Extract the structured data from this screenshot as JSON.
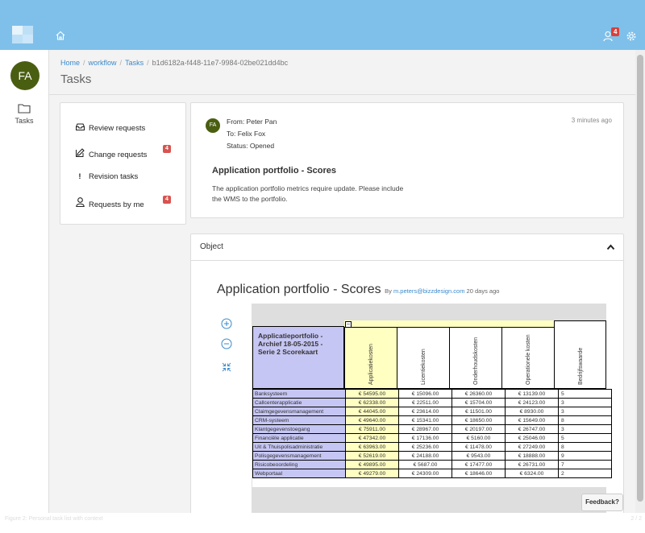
{
  "topbar": {
    "notification_count": "4"
  },
  "sidebar": {
    "avatar_initials": "FA",
    "items": [
      {
        "label": "Tasks"
      }
    ]
  },
  "breadcrumb": {
    "home": "Home",
    "workflow": "workflow",
    "tasks": "Tasks",
    "current": "b1d6182a-f448-11e7-9984-02be021dd4bc"
  },
  "page": {
    "title": "Tasks"
  },
  "menu": {
    "items": [
      {
        "label": "Review requests",
        "icon": "inbox-icon",
        "badge": ""
      },
      {
        "label": "Change requests",
        "icon": "edit-icon",
        "badge": "4"
      },
      {
        "label": "Revision tasks",
        "icon": "exclamation-icon",
        "badge": ""
      },
      {
        "label": "Requests by me",
        "icon": "user-icon",
        "badge": "4"
      }
    ]
  },
  "message": {
    "avatar_initials": "FA",
    "from": "From: Peter Pan",
    "to": "To: Felix Fox",
    "status": "Status: Opened",
    "time": "3 minutes ago",
    "subject": "Application portfolio - Scores",
    "body": "The application portfolio metrics require update. Please include the WMS to the portfolio."
  },
  "object_panel": {
    "label": "Object",
    "diagram_title": "Application portfolio - Scores",
    "by": "By",
    "author_email": "m.peters@bizzdesign.com",
    "age": "20 days ago"
  },
  "scorecard": {
    "header": "Applicatieportfolio - Archief 18-05-2015 - Serie 2 Scorekaart",
    "collapse": "−",
    "columns": [
      "Applicatiekosten",
      "Licentiekosten",
      "Onderhoudskosten",
      "Operationele kosten",
      "Bedrijfswaarde"
    ],
    "rows": [
      {
        "name": "Banksysteem",
        "app": "€ 54595.00",
        "lic": "€ 15096.00",
        "ond": "€ 26360.00",
        "ope": "€ 13139.00",
        "bw": "5"
      },
      {
        "name": "Callcenterapplicatie",
        "app": "€ 62338.00",
        "lic": "€ 22511.00",
        "ond": "€ 15704.00",
        "ope": "€ 24123.00",
        "bw": "3"
      },
      {
        "name": "Claimgegevensmanagement",
        "app": "€ 44045.00",
        "lic": "€ 23614.00",
        "ond": "€ 11501.00",
        "ope": "€ 8930.00",
        "bw": "3"
      },
      {
        "name": "CRM-systeem",
        "app": "€ 49640.00",
        "lic": "€ 15341.00",
        "ond": "€ 18650.00",
        "ope": "€ 15649.00",
        "bw": "8"
      },
      {
        "name": "Klantgegevenstoegang",
        "app": "€ 75911.00",
        "lic": "€ 28967.00",
        "ond": "€ 20197.00",
        "ope": "€ 26747.00",
        "bw": "3"
      },
      {
        "name": "Financiële applicatie",
        "app": "€ 47342.00",
        "lic": "€ 17136.00",
        "ond": "€ 5160.00",
        "ope": "€ 25046.00",
        "bw": "5"
      },
      {
        "name": "Uit & Thuispolisadministratie",
        "app": "€ 63963.00",
        "lic": "€ 25236.00",
        "ond": "€ 11478.00",
        "ope": "€ 27249.00",
        "bw": "8"
      },
      {
        "name": "Polisgegevensmanagement",
        "app": "€ 52619.00",
        "lic": "€ 24188.00",
        "ond": "€ 9543.00",
        "ope": "€ 18888.00",
        "bw": "9"
      },
      {
        "name": "Risicobeoordeling",
        "app": "€ 49895.00",
        "lic": "€ 5687.00",
        "ond": "€ 17477.00",
        "ope": "€ 26731.00",
        "bw": "7"
      },
      {
        "name": "Webportaal",
        "app": "€ 49279.00",
        "lic": "€ 24309.00",
        "ond": "€ 18646.00",
        "ope": "€ 6324.00",
        "bw": "2"
      }
    ]
  },
  "feedback": {
    "label": "Feedback?"
  },
  "footer": {
    "caption": "Figure 2: Personal task list with context",
    "page": "2 / 2"
  },
  "colors": {
    "topbar": "#7fc0ea",
    "avatar": "#4a5e11",
    "badge": "#d9534f",
    "link": "#3a8acb",
    "header_fill": "#c6c6f4",
    "highlight_fill": "#ffffc2"
  }
}
